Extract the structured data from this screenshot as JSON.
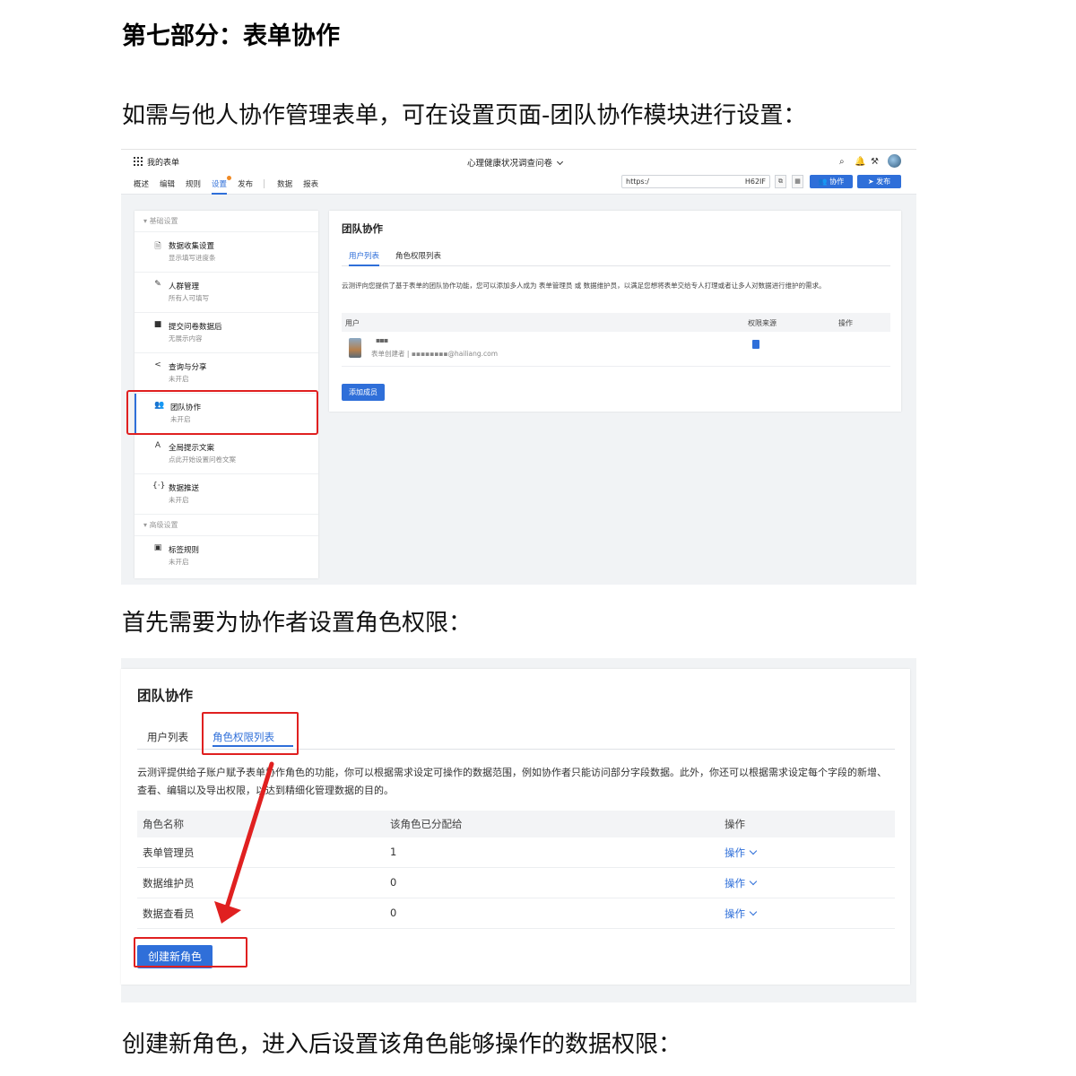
{
  "doc": {
    "title": "第七部分：表单协作",
    "para1": "如需与他人协作管理表单，可在设置页面-团队协作模块进行设置：",
    "para2": "首先需要为协作者设置角色权限：",
    "para3": "创建新角色，进入后设置该角色能够操作的数据权限："
  },
  "shot1": {
    "app_title": "我的表单",
    "survey_title": "心理健康状况调查问卷",
    "nav_tabs": [
      "概述",
      "编辑",
      "规则",
      "设置",
      "发布",
      "数据",
      "报表"
    ],
    "url_prefix": "https:/",
    "url_code": "H62IF",
    "collab_button": "协作",
    "publish_button": "发布",
    "icons": [
      "grid-icon",
      "search-icon",
      "bell-icon",
      "tools-icon"
    ],
    "sidebar": {
      "group_basic": "基础设置",
      "group_advanced": "高级设置",
      "items": [
        {
          "icon": "🗎",
          "name": "数据收集设置",
          "desc": "显示填写进度条"
        },
        {
          "icon": "✎",
          "name": "人群管理",
          "desc": "所有人可填写"
        },
        {
          "icon": "■",
          "name": "提交问卷数据后",
          "desc": "无展示内容"
        },
        {
          "icon": "<",
          "name": "查询与分享",
          "desc": "未开启"
        },
        {
          "icon": "👥",
          "name": "团队协作",
          "desc": "未开启"
        },
        {
          "icon": "A",
          "name": "全局提示文案",
          "desc": "点此开始设置问卷文案"
        },
        {
          "icon": "{·}",
          "name": "数据推送",
          "desc": "未开启"
        },
        {
          "icon": "▣",
          "name": "标签规则",
          "desc": "未开启"
        }
      ]
    },
    "panel": {
      "title": "团队协作",
      "tab_users": "用户列表",
      "tab_roles": "角色权限列表",
      "desc": "云测评向您提供了基于表单的团队协作功能，您可以添加多人成为 表单管理员 或 数据维护员，以满足您想将表单交给专人打理或者让多人对数据进行维护的需求。",
      "col_user": "用户",
      "col_source": "权限来源",
      "col_action": "操作",
      "user_name": "▪▪▪",
      "user_role": "表单创建者 |  ▪▪▪▪▪▪▪▪@hailiang.com",
      "add_member": "添加成员"
    }
  },
  "shot2": {
    "title": "团队协作",
    "tab_users": "用户列表",
    "tab_roles": "角色权限列表",
    "desc": "云测评提供给子账户赋予表单协作角色的功能，你可以根据需求设定可操作的数据范围，例如协作者只能访问部分字段数据。此外，你还可以根据需求设定每个字段的新增、查看、编辑以及导出权限，以达到精细化管理数据的目的。",
    "table": {
      "headers": [
        "角色名称",
        "该角色已分配给",
        "操作"
      ],
      "rows": [
        {
          "name": "表单管理员",
          "count": "1",
          "action": "操作"
        },
        {
          "name": "数据维护员",
          "count": "0",
          "action": "操作"
        },
        {
          "name": "数据查看员",
          "count": "0",
          "action": "操作"
        }
      ]
    },
    "create_button": "创建新角色",
    "highlight_color": "#e02020",
    "accent_color": "#2f6fd9"
  }
}
